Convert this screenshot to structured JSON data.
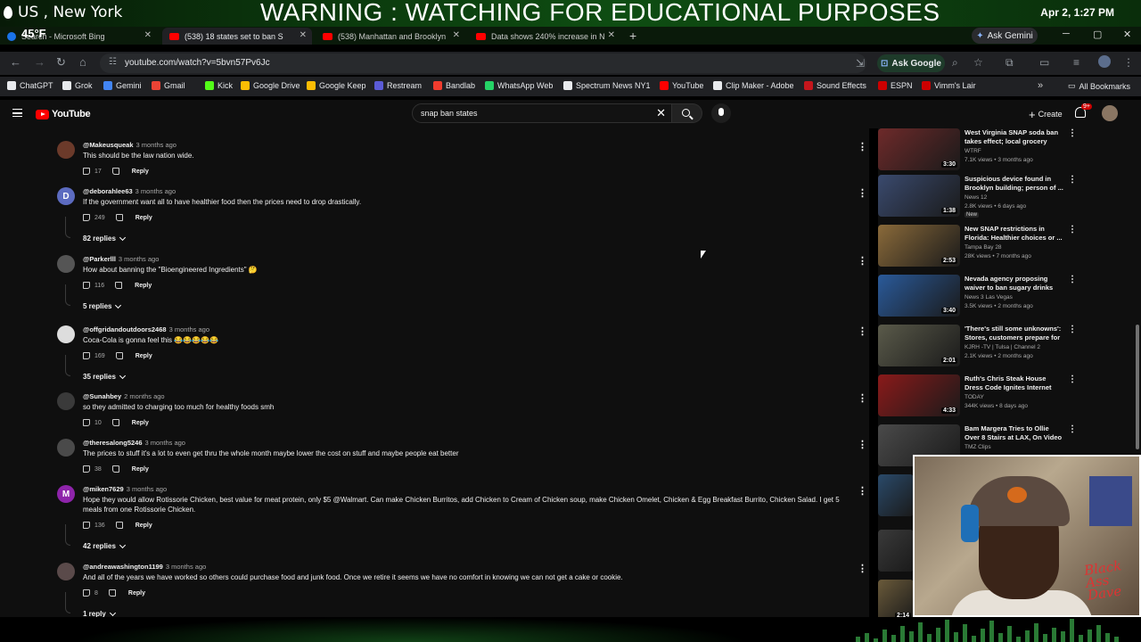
{
  "overlay": {
    "location": "US , New York",
    "warning": "WARNING : WATCHING FOR EDUCATIONAL PURPOSES",
    "datetime": "Apr 2, 1:27 PM",
    "temperature": "45°F"
  },
  "tabs": [
    {
      "label": "Search - Microsoft Bing",
      "icon": "bing-icon",
      "active": false
    },
    {
      "label": "(538) 18 states set to ban S",
      "icon": "youtube-icon",
      "active": true
    },
    {
      "label": "(538) Manhattan and Brooklyn",
      "icon": "youtube-icon",
      "active": false
    },
    {
      "label": "Data shows 240% increase in N",
      "icon": "youtube-icon",
      "active": false
    }
  ],
  "browser": {
    "ask_gemini": "Ask Gemini",
    "url": "youtube.com/watch?v=5bvn57Pv6Jc",
    "ask_google": "Ask Google"
  },
  "bookmarks": [
    {
      "label": "ChatGPT",
      "color": "#e8eaed"
    },
    {
      "label": "Grok",
      "color": "#e8eaed"
    },
    {
      "label": "Gemini",
      "color": "#4285f4"
    },
    {
      "label": "Gmail",
      "color": "#ea4335"
    },
    {
      "label": "Kick",
      "color": "#53fc18"
    },
    {
      "label": "Google Drive",
      "color": "#fbbc04"
    },
    {
      "label": "Google Keep",
      "color": "#fbbc04"
    },
    {
      "label": "Restream",
      "color": "#5b5bd6"
    },
    {
      "label": "Bandlab",
      "color": "#f03c2e"
    },
    {
      "label": "WhatsApp Web",
      "color": "#25d366"
    },
    {
      "label": "Spectrum News NY1",
      "color": "#e8eaed"
    },
    {
      "label": "YouTube",
      "color": "#ff0000"
    },
    {
      "label": "Clip Maker - Adobe",
      "color": "#e8eaed"
    },
    {
      "label": "Sound Effects",
      "color": "#c4161c"
    },
    {
      "label": "ESPN",
      "color": "#cc0000"
    },
    {
      "label": "Vimm's Lair",
      "color": "#cc0000"
    }
  ],
  "bookmarks_all": "All Bookmarks",
  "youtube": {
    "logo": "YouTube",
    "search_query": "snap ban states",
    "create_label": "Create",
    "notification_count": "9+"
  },
  "comments": [
    {
      "user": "@Makeusqueak",
      "time": "3 months ago",
      "text": "This should be the law nation wide.",
      "likes": "17",
      "reply": "Reply",
      "avatar_color": "#6b3a2a",
      "avatar_letter": "",
      "replies": ""
    },
    {
      "user": "@deborahlee63",
      "time": "3 months ago",
      "text": "If the government want all to have healthier food then the prices need to drop drastically.",
      "likes": "249",
      "reply": "Reply",
      "avatar_color": "#5c6bc0",
      "avatar_letter": "D",
      "replies": "82 replies"
    },
    {
      "user": "@Parkerlll",
      "time": "3 months ago",
      "text": "How about banning the \"Bioengineered Ingredients\" 🤔",
      "likes": "116",
      "reply": "Reply",
      "avatar_color": "#555555",
      "avatar_letter": "",
      "replies": "5 replies"
    },
    {
      "user": "@offgridandoutdoors2468",
      "time": "3 months ago",
      "text": "Coca-Cola is gonna feel this 😂😂😂😂😂",
      "likes": "169",
      "reply": "Reply",
      "avatar_color": "#dddddd",
      "avatar_letter": "",
      "replies": "35 replies"
    },
    {
      "user": "@Sunahbey",
      "time": "2 months ago",
      "text": "so they admitted to charging too much for healthy foods smh",
      "likes": "10",
      "reply": "Reply",
      "avatar_color": "#3a3a3a",
      "avatar_letter": "",
      "replies": ""
    },
    {
      "user": "@theresalong5246",
      "time": "3 months ago",
      "text": "The prices to stuff it's a lot to even get thru the whole month maybe lower the cost on stuff and maybe people eat better",
      "likes": "38",
      "reply": "Reply",
      "avatar_color": "#4a4a4a",
      "avatar_letter": "",
      "replies": ""
    },
    {
      "user": "@miken7629",
      "time": "3 months ago",
      "text": "Hope they would allow Rotissorie Chicken, best value for meat protein, only $5 @Walmart.  Can make Chicken Burritos, add Chicken to Cream of Chicken soup, make Chicken Omelet, Chicken & Egg Breakfast Burrito, Chicken Salad.  I get 5 meals from one Rotissorie Chicken.",
      "likes": "136",
      "reply": "Reply",
      "avatar_color": "#8e24aa",
      "avatar_letter": "M",
      "replies": "42 replies"
    },
    {
      "user": "@andreawashington1199",
      "time": "3 months ago",
      "text": "And all of the years we have worked so others could purchase food and junk food. Once we retire it seems we have no comfort in knowing we can not get a cake or cookie.",
      "likes": "8",
      "reply": "Reply",
      "avatar_color": "#5a4a4a",
      "avatar_letter": "",
      "replies": "1 reply"
    }
  ],
  "related_videos": [
    {
      "title": "West Virginia SNAP soda ban takes effect; local grocery stor...",
      "channel": "WTRF",
      "meta": "7.1K views • 3 months ago",
      "duration": "3:30",
      "thumb_color": "#6e2a2a",
      "is_new": false,
      "new_label": ""
    },
    {
      "title": "Suspicious device found in Brooklyn building; person of ...",
      "channel": "News 12",
      "meta": "2.8K views • 6 days ago",
      "duration": "1:38",
      "thumb_color": "#3a4a6e",
      "is_new": true,
      "new_label": "New"
    },
    {
      "title": "New SNAP restrictions in Florida: Healthier choices or ...",
      "channel": "Tampa Bay 28",
      "meta": "28K views • 7 months ago",
      "duration": "2:53",
      "thumb_color": "#8a6a3a",
      "is_new": false,
      "new_label": ""
    },
    {
      "title": "Nevada agency proposing waiver to ban sugary drinks fo...",
      "channel": "News 3 Las Vegas",
      "meta": "3.5K views • 2 months ago",
      "duration": "3:40",
      "thumb_color": "#2a5a9a",
      "is_new": false,
      "new_label": ""
    },
    {
      "title": "'There's still some unknowns': Stores, customers prepare for ...",
      "channel": "KJRH -TV | Tulsa | Channel 2",
      "meta": "2.1K views • 2 months ago",
      "duration": "2:01",
      "thumb_color": "#5a5a4a",
      "is_new": false,
      "new_label": ""
    },
    {
      "title": "Ruth's Chris Steak House Dress Code Ignites Internet Debate",
      "channel": "TODAY",
      "meta": "344K views • 8 days ago",
      "duration": "4:33",
      "thumb_color": "#8a1a1a",
      "is_new": false,
      "new_label": ""
    },
    {
      "title": "Bam Margera Tries to Ollie Over 8 Stairs at LAX, On Video | TMZ",
      "channel": "TMZ Clips",
      "meta": "",
      "duration": "",
      "thumb_color": "#4a4a4a",
      "is_new": false,
      "new_label": ""
    },
    {
      "title": "",
      "channel": "",
      "meta": "",
      "duration": "",
      "thumb_color": "#2a4a6a",
      "is_new": false,
      "new_label": ""
    },
    {
      "title": "",
      "channel": "",
      "meta": "",
      "duration": "",
      "thumb_color": "#3a3a3a",
      "is_new": false,
      "new_label": ""
    },
    {
      "title": "",
      "channel": "",
      "meta": "",
      "duration": "2:14",
      "thumb_color": "#6a5a3a",
      "is_new": false,
      "new_label": ""
    }
  ],
  "webcam": {
    "signature": "Black Ass Dave"
  }
}
